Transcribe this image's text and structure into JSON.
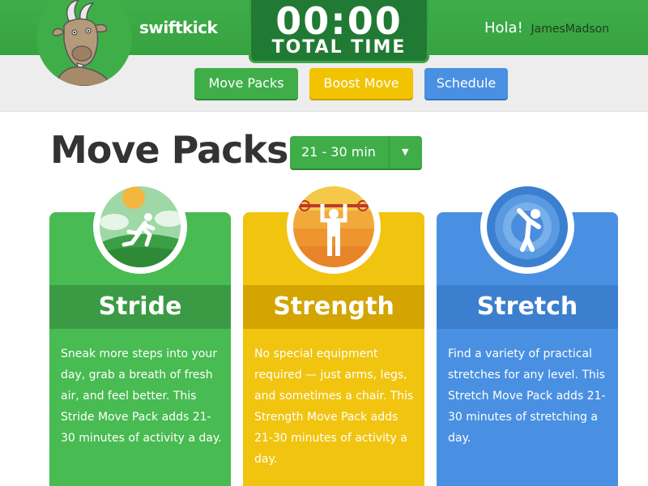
{
  "header": {
    "brand": "swiftkick",
    "timer": {
      "digits": "00:00",
      "label": "TOTAL TIME"
    },
    "greeting": "Hola!",
    "username": "JamesMadson"
  },
  "nav": {
    "move_packs": "Move Packs",
    "boost_move": "Boost Move",
    "schedule": "Schedule"
  },
  "page": {
    "title": "Move Packs",
    "duration_select": {
      "value": "21 - 30 min"
    }
  },
  "cards": [
    {
      "title": "Stride",
      "description": "Sneak more steps into your day, grab a breath of fresh air, and feel better. This Stride Move Pack adds 21-30 minutes of activity a day.",
      "color": "#48bb52",
      "icon": "runner-icon"
    },
    {
      "title": "Strength",
      "description": "No special equipment required — just arms, legs, and sometimes a chair. This Strength Move Pack adds 21-30 minutes of activity a day.",
      "color": "#f1c40f",
      "icon": "weightlifter-icon"
    },
    {
      "title": "Stretch",
      "description": "Find a variety of practical stretches for any level. This Stretch Move Pack adds 21-30 minutes of stretching a day.",
      "color": "#4a90e2",
      "icon": "stretching-figure-icon"
    }
  ],
  "colors": {
    "brand_green": "#3fae49",
    "timer_green": "#217a33",
    "boost_yellow": "#f2c300",
    "schedule_blue": "#4a90e2"
  }
}
